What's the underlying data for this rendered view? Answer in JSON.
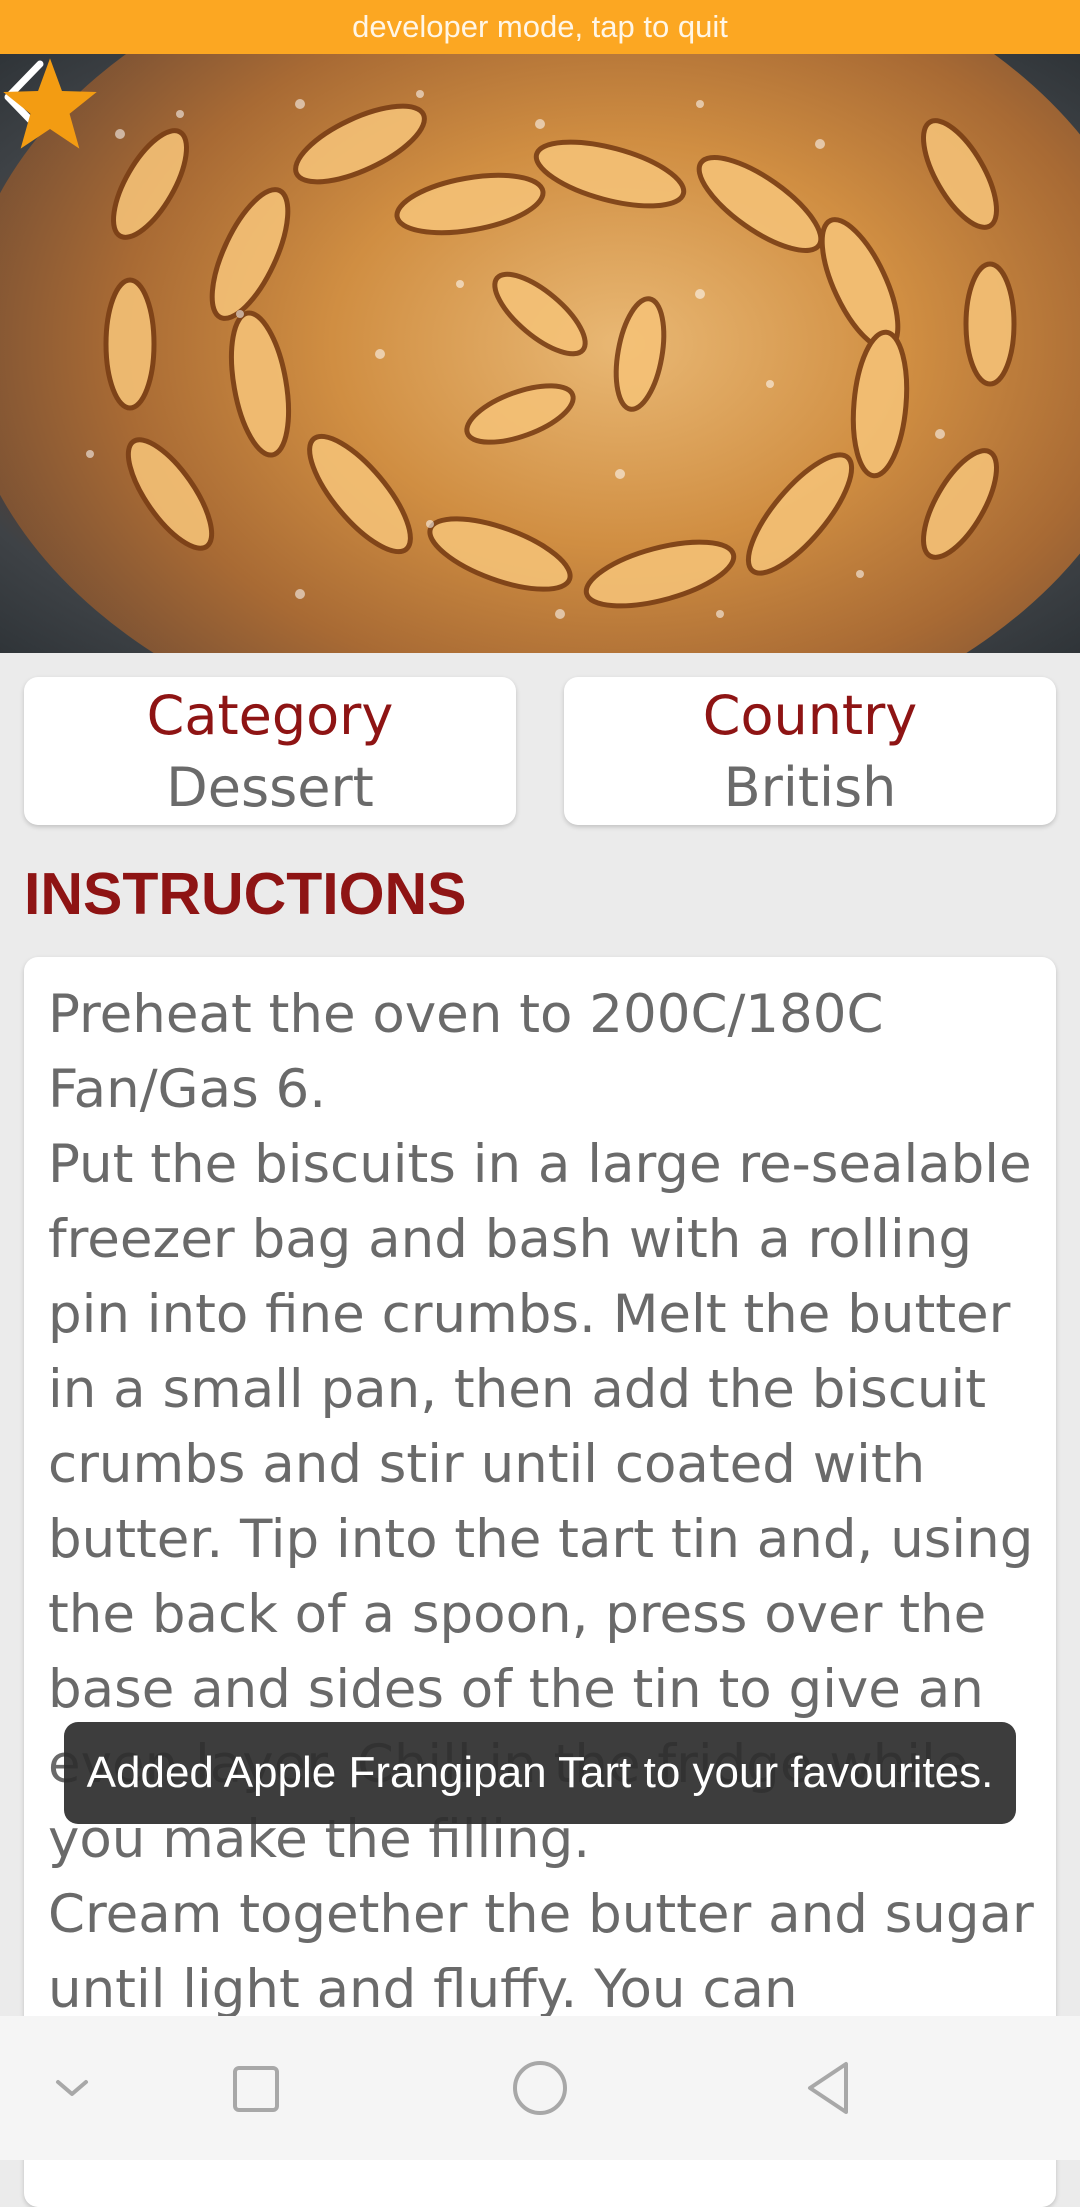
{
  "dev_banner": {
    "text": "developer mode, tap to quit"
  },
  "header": {
    "back_icon": "arrow-left-icon",
    "favourite_icon": "star-icon",
    "favourite_color": "#f39c12"
  },
  "info": {
    "category_label": "Category",
    "category_value": "Dessert",
    "country_label": "Country",
    "country_value": "British"
  },
  "instructions": {
    "title": "INSTRUCTIONS",
    "text": "Preheat the oven to 200C/180C Fan/Gas 6.\nPut the biscuits in a large re-sealable freezer bag and bash with a rolling pin into fine crumbs. Melt the butter in a small pan, then add the biscuit crumbs and stir until coated with butter. Tip into the tart tin and, using the back of a spoon, press over the base and sides of the tin to give an even layer. Chill in the fridge while you make the filling.\nCream together the butter and sugar until light and fluffy. You can"
  },
  "toast": {
    "text": "Added Apple Frangipan Tart to your favourites."
  },
  "nav_bar": {
    "icons": [
      "chevron-down-icon",
      "square-icon",
      "circle-icon",
      "triangle-back-icon"
    ]
  },
  "colors": {
    "accent": "#8e1414",
    "dev_banner": "#fca722",
    "background": "#ebebeb"
  }
}
